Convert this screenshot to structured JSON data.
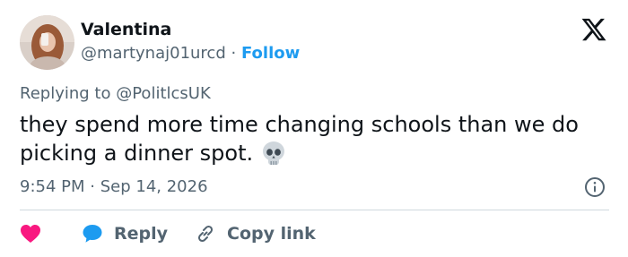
{
  "author": {
    "name": "Valentina",
    "handle": "@martynaj01urcd",
    "separator": "·",
    "follow_label": "Follow"
  },
  "reply_context": {
    "prefix": "Replying to",
    "handle": "@PolitlcsUK"
  },
  "tweet": {
    "text": "they spend more time changing schools than we do picking a dinner spot.",
    "emoji_icon": "skull-emoji-icon"
  },
  "meta": {
    "time": "9:54 PM",
    "separator": "·",
    "date": "Sep 14, 2026"
  },
  "actions": {
    "reply_label": "Reply",
    "copy_link_label": "Copy link"
  },
  "colors": {
    "accent": "#1d9bf0",
    "like": "#f91880",
    "secondary_text": "#536471",
    "divider": "#cfd9de"
  }
}
